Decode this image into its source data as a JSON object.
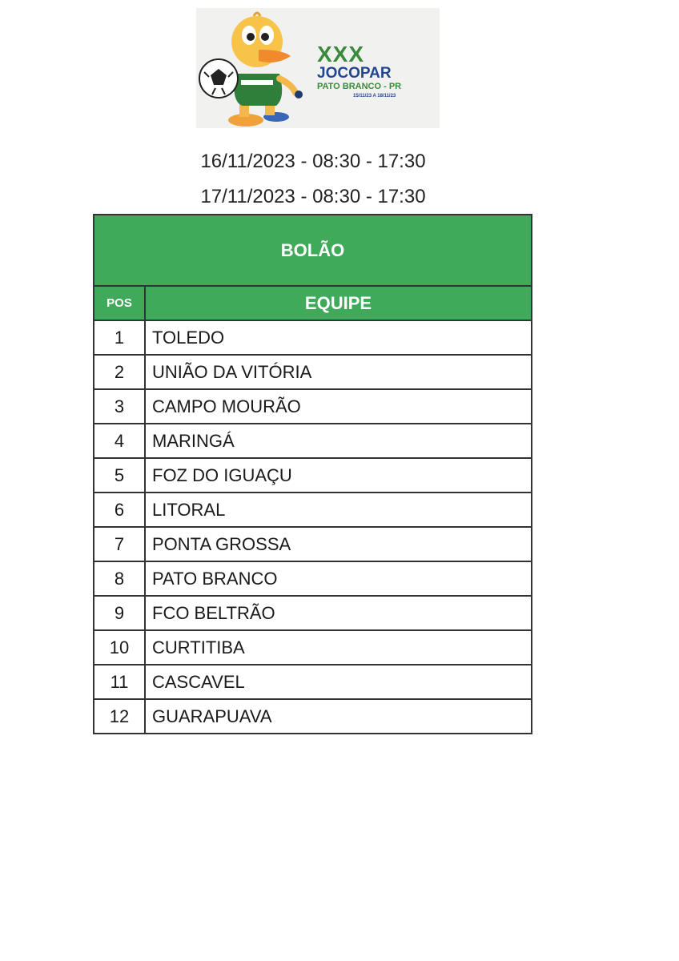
{
  "logo": {
    "line1": "XXX",
    "line2": "JOCOPAR",
    "line3": "PATO BRANCO - PR",
    "line4": "15/11/23 A 18/11/23",
    "mascot_icon": "duck-mascot-with-soccer-ball-icon"
  },
  "dates": [
    "16/11/2023 - 08:30 - 17:30",
    "17/11/2023 - 08:30 - 17:30"
  ],
  "table": {
    "title": "BOLÃO",
    "pos_header": "POS",
    "team_header": "EQUIPE",
    "rows": [
      {
        "pos": "1",
        "team": "TOLEDO"
      },
      {
        "pos": "2",
        "team": "UNIÃO DA VITÓRIA"
      },
      {
        "pos": "3",
        "team": "CAMPO MOURÃO"
      },
      {
        "pos": "4",
        "team": "MARINGÁ"
      },
      {
        "pos": "5",
        "team": "FOZ DO IGUAÇU"
      },
      {
        "pos": "6",
        "team": "LITORAL"
      },
      {
        "pos": "7",
        "team": "PONTA GROSSA"
      },
      {
        "pos": "8",
        "team": "PATO BRANCO"
      },
      {
        "pos": "9",
        "team": "FCO BELTRÃO"
      },
      {
        "pos": "10",
        "team": "CURTITIBA"
      },
      {
        "pos": "11",
        "team": "CASCAVEL"
      },
      {
        "pos": "12",
        "team": "GUARAPUAVA"
      }
    ]
  },
  "colors": {
    "header_green": "#3faa5a",
    "logo_green": "#3a8a3c",
    "logo_blue": "#23478f"
  }
}
